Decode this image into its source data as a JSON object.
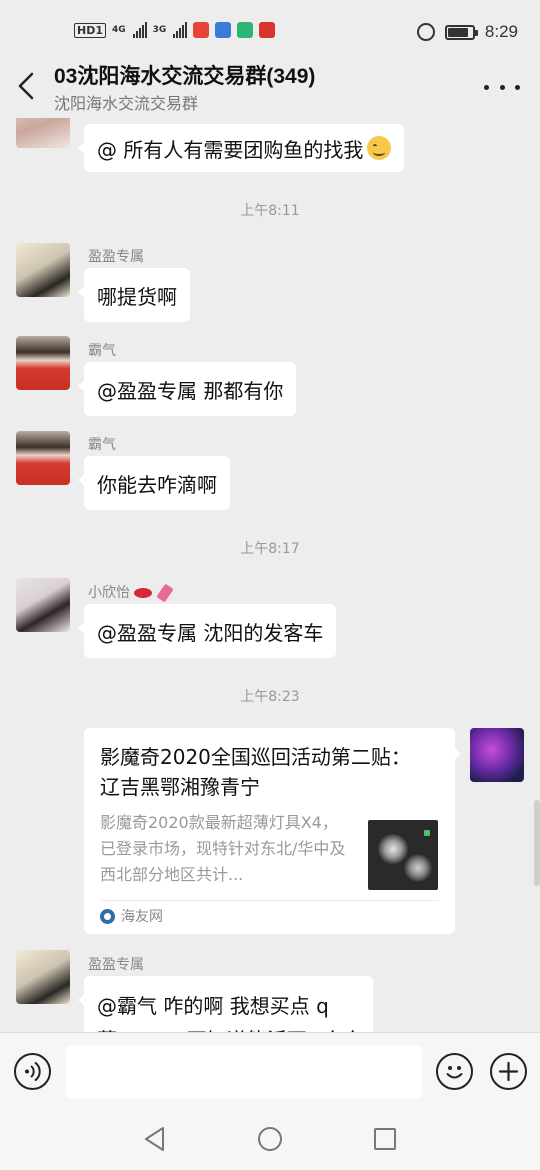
{
  "status_bar": {
    "hd_label": "HD",
    "hd_sub": "1",
    "net1": "4G",
    "net2": "3G",
    "time": "8:29",
    "battery_level": 0.85
  },
  "header": {
    "title": "03沈阳海水交流交易群(349)",
    "subtitle": "沈阳海水交流交易群"
  },
  "messages": [
    {
      "sender": "",
      "text": "@ 所有人有需要团购鱼的找我"
    },
    {
      "timestamp": "上午8:11"
    },
    {
      "sender": "盈盈专属",
      "text": "哪提货啊"
    },
    {
      "sender": "霸气",
      "text": "@盈盈专属  那都有你"
    },
    {
      "sender": "霸气",
      "text": "你能去咋滴啊"
    },
    {
      "timestamp": "上午8:17"
    },
    {
      "sender": "小欣怡",
      "text": "@盈盈专属  沈阳的发客车"
    },
    {
      "timestamp": "上午8:23"
    },
    {
      "sender": "盈盈专属",
      "text_line1": "@霸气  咋的啊 我想买点 q",
      "text_line2": "菜           不知道能活不  哈哈"
    }
  ],
  "link_card": {
    "title": "影魔奇2020全国巡回活动第二贴：  辽吉黑鄂湘豫青宁",
    "description": "影魔奇2020款最新超薄灯具X4，已登录市场，现特针对东北/华中及西北部分地区共计...",
    "source": "海友网"
  },
  "input": {
    "placeholder": ""
  },
  "colors": {
    "background": "#ededed",
    "bubble": "#ffffff",
    "timestamp": "#999999"
  }
}
